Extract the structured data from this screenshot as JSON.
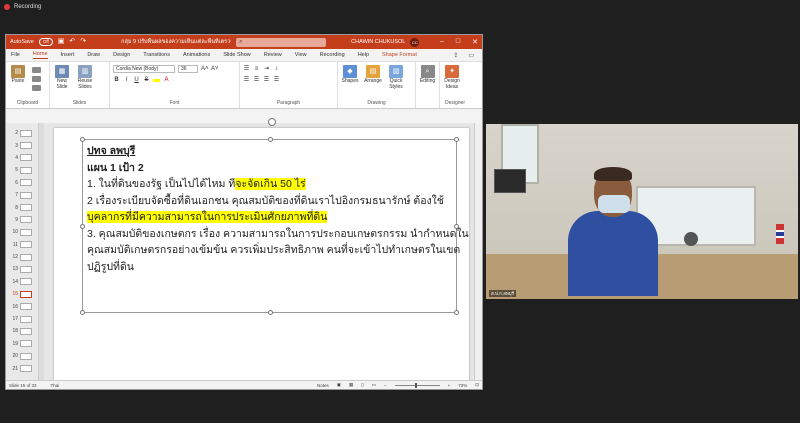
{
  "recording": {
    "label": "Recording",
    "color": "#e03a3a"
  },
  "titlebar": {
    "autosave_label": "AutoSave",
    "autosave_state": "Off",
    "filename": "กลุ่ม 9 ปรับพื้นผลของความเห็นเเต่ละพื้นที่เตรวจร่วม.pptx",
    "search_placeholder": "",
    "user_name": "CHAWIN CHUKUSOL",
    "user_initials": "CC",
    "accent": "#c43e1c"
  },
  "tabs": [
    "File",
    "Home",
    "Insert",
    "Draw",
    "Design",
    "Transitions",
    "Animations",
    "Slide Show",
    "Review",
    "View",
    "Recording",
    "Help",
    "Shape Format"
  ],
  "active_tab": "Home",
  "ribbon": {
    "clipboard": {
      "paste": "Paste",
      "label": "Clipboard"
    },
    "slides": {
      "new_slide": "New Slide",
      "reuse_slides": "Reuse Slides",
      "label": "Slides"
    },
    "font": {
      "name": "Cordia New (Body)",
      "size": "36",
      "label": "Font",
      "grow": "A˄",
      "shrink": "A˅",
      "bold": "B",
      "italic": "I",
      "underline": "U",
      "strike": "S"
    },
    "paragraph": {
      "label": "Paragraph"
    },
    "drawing": {
      "shapes": "Shapes",
      "arrange": "Arrange",
      "quick_styles": "Quick Styles",
      "label": "Drawing"
    },
    "editing": {
      "label": "Editing"
    },
    "designer": {
      "design_ideas": "Design Ideas",
      "label": "Designer"
    }
  },
  "thumbnails": {
    "numbers": [
      "2",
      "3",
      "4",
      "5",
      "6",
      "7",
      "8",
      "9",
      "10",
      "11",
      "12",
      "13",
      "14",
      "15",
      "16",
      "17",
      "18",
      "19",
      "20",
      "21"
    ],
    "selected": "15"
  },
  "slide": {
    "lines": [
      {
        "text": "ปทจ ลพบุรี"
      },
      {
        "text": "แผน 1 เป้า 2"
      },
      {
        "pre": "1. ในที่ดินของรัฐ เป็นไปได้ไหม ที",
        "hl": "จะจัดเกิน 50 ไร่"
      },
      {
        "text": "2 เรื่องระเบียบจัดซื้อที่ดินเอกชน คุณสมบัติของที่ดินเราไปอิงกรมธนารักษ์ ต้องใช้"
      },
      {
        "hl": "บุคลากรที่มีความสามารถในการประเมินศักยภาพที่ดิน"
      },
      {
        "text": "3. คุณสมบัติของเกษตกร เรื่อง ความสามารถในการประกอบเกษตรกรรม นำกำหนดใน"
      },
      {
        "text": "คุณสมบัติเกษตรกรอย่างเข้มข้น ควรเพิ่มประสิทธิภาพ คนที่จะเข้าไปทำเกษตรในเขต"
      },
      {
        "text": "ปฏิรูปที่ดิน"
      }
    ]
  },
  "status": {
    "slide": "Slide 15 of 33",
    "language": "Thai",
    "notes": "Notes",
    "zoom": "73%"
  },
  "video": {
    "label": "ส.ป.ก.ลพบุรี"
  }
}
